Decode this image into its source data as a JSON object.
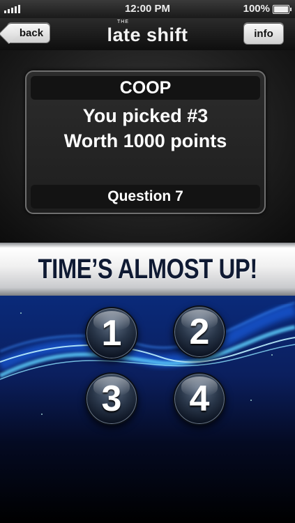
{
  "status_bar": {
    "time": "12:00 PM",
    "battery": "100%",
    "battery_level": 1.0
  },
  "nav": {
    "back_label": "back",
    "logo_small": "THE",
    "logo_name": "late shift",
    "info_label": "info"
  },
  "card": {
    "player": "COOP",
    "pick_line": "You picked #3",
    "worth_line": "Worth 1000 points",
    "question": "Question 7"
  },
  "banner": {
    "text": "TIME’S ALMOST UP!"
  },
  "answers": [
    "1",
    "2",
    "3",
    "4"
  ],
  "colors": {
    "banner_text": "#0f1a33",
    "wave_glow": "#5fd0ff",
    "wave_blue": "#1a4fd6"
  }
}
